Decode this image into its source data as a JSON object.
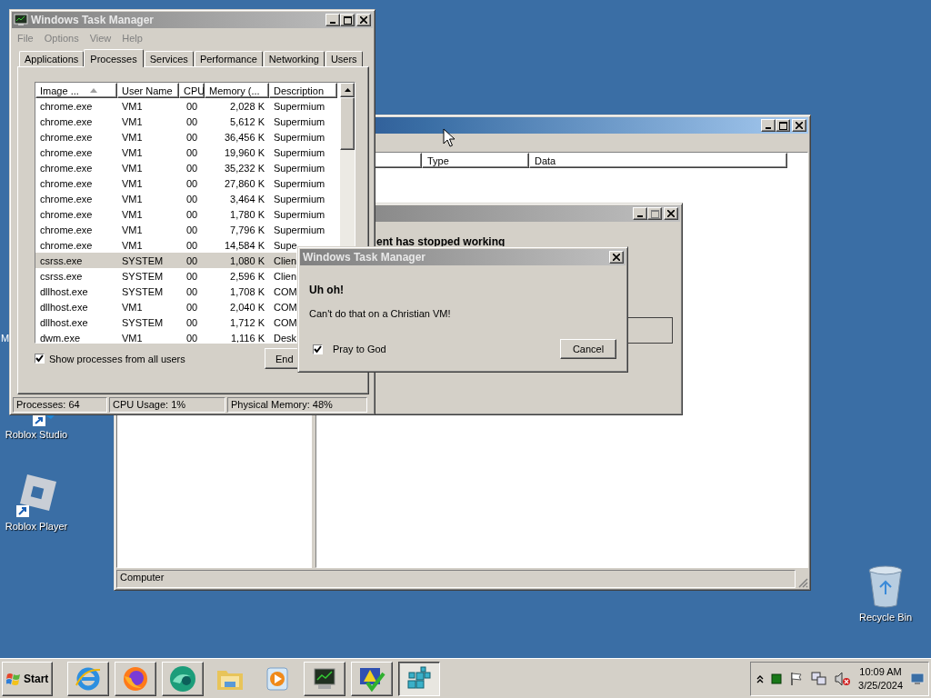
{
  "desktop": {
    "icons": [
      {
        "kind": "partial",
        "label": "M"
      },
      {
        "kind": "studio",
        "label": "Roblox Studio"
      },
      {
        "kind": "player",
        "label": "Roblox Player"
      },
      {
        "kind": "bin",
        "label": "Recycle Bin"
      }
    ]
  },
  "registry_window": {
    "columns": [
      "Type",
      "Data"
    ],
    "status": "Computer"
  },
  "error_window": {
    "message": "ent has stopped working"
  },
  "task_manager": {
    "title": "Windows Task Manager",
    "menu": [
      "File",
      "Options",
      "View",
      "Help"
    ],
    "tabs": [
      {
        "label": "Applications",
        "selected": false
      },
      {
        "label": "Processes",
        "selected": true
      },
      {
        "label": "Services",
        "selected": false
      },
      {
        "label": "Performance",
        "selected": false
      },
      {
        "label": "Networking",
        "selected": false
      },
      {
        "label": "Users",
        "selected": false
      }
    ],
    "columns": [
      "Image ...",
      "User Name",
      "CPU",
      "Memory (...",
      "Description"
    ],
    "rows": [
      {
        "image": "chrome.exe",
        "user": "VM1",
        "cpu": "00",
        "memory": "2,028 K",
        "description": "Supermium",
        "selected": false
      },
      {
        "image": "chrome.exe",
        "user": "VM1",
        "cpu": "00",
        "memory": "5,612 K",
        "description": "Supermium",
        "selected": false
      },
      {
        "image": "chrome.exe",
        "user": "VM1",
        "cpu": "00",
        "memory": "36,456 K",
        "description": "Supermium",
        "selected": false
      },
      {
        "image": "chrome.exe",
        "user": "VM1",
        "cpu": "00",
        "memory": "19,960 K",
        "description": "Supermium",
        "selected": false
      },
      {
        "image": "chrome.exe",
        "user": "VM1",
        "cpu": "00",
        "memory": "35,232 K",
        "description": "Supermium",
        "selected": false
      },
      {
        "image": "chrome.exe",
        "user": "VM1",
        "cpu": "00",
        "memory": "27,860 K",
        "description": "Supermium",
        "selected": false
      },
      {
        "image": "chrome.exe",
        "user": "VM1",
        "cpu": "00",
        "memory": "3,464 K",
        "description": "Supermium",
        "selected": false
      },
      {
        "image": "chrome.exe",
        "user": "VM1",
        "cpu": "00",
        "memory": "1,780 K",
        "description": "Supermium",
        "selected": false
      },
      {
        "image": "chrome.exe",
        "user": "VM1",
        "cpu": "00",
        "memory": "7,796 K",
        "description": "Supermium",
        "selected": false
      },
      {
        "image": "chrome.exe",
        "user": "VM1",
        "cpu": "00",
        "memory": "14,584 K",
        "description": "Supe",
        "selected": false
      },
      {
        "image": "csrss.exe",
        "user": "SYSTEM",
        "cpu": "00",
        "memory": "1,080 K",
        "description": "Clien",
        "selected": true
      },
      {
        "image": "csrss.exe",
        "user": "SYSTEM",
        "cpu": "00",
        "memory": "2,596 K",
        "description": "Clien",
        "selected": false
      },
      {
        "image": "dllhost.exe",
        "user": "SYSTEM",
        "cpu": "00",
        "memory": "1,708 K",
        "description": "COM",
        "selected": false
      },
      {
        "image": "dllhost.exe",
        "user": "VM1",
        "cpu": "00",
        "memory": "2,040 K",
        "description": "COM",
        "selected": false
      },
      {
        "image": "dllhost.exe",
        "user": "SYSTEM",
        "cpu": "00",
        "memory": "1,712 K",
        "description": "COM",
        "selected": false
      },
      {
        "image": "dwm.exe",
        "user": "VM1",
        "cpu": "00",
        "memory": "1,116 K",
        "description": "Desk",
        "selected": false
      }
    ],
    "show_all": {
      "label": "Show processes from all users",
      "checked": true
    },
    "end_button": "End",
    "status": [
      "Processes: 64",
      "CPU Usage: 1%",
      "Physical Memory: 48%"
    ]
  },
  "dialog": {
    "title": "Windows Task Manager",
    "heading": "Uh oh!",
    "message": "Can't do that on a Christian VM!",
    "checkbox": {
      "label": "Pray to God",
      "checked": true
    },
    "button": "Cancel"
  },
  "taskbar": {
    "start": "Start",
    "items": [
      {
        "kind": "ie",
        "running": true,
        "selected": false
      },
      {
        "kind": "firefox",
        "running": true,
        "selected": false
      },
      {
        "kind": "orb",
        "running": true,
        "selected": false
      },
      {
        "kind": "folder",
        "running": false,
        "selected": false
      },
      {
        "kind": "media",
        "running": false,
        "selected": false
      },
      {
        "kind": "monitor",
        "running": true,
        "selected": false
      },
      {
        "kind": "security",
        "running": true,
        "selected": false
      },
      {
        "kind": "registry",
        "running": true,
        "selected": true
      }
    ],
    "clock": {
      "time": "10:09 AM",
      "date": "3/25/2024"
    }
  }
}
